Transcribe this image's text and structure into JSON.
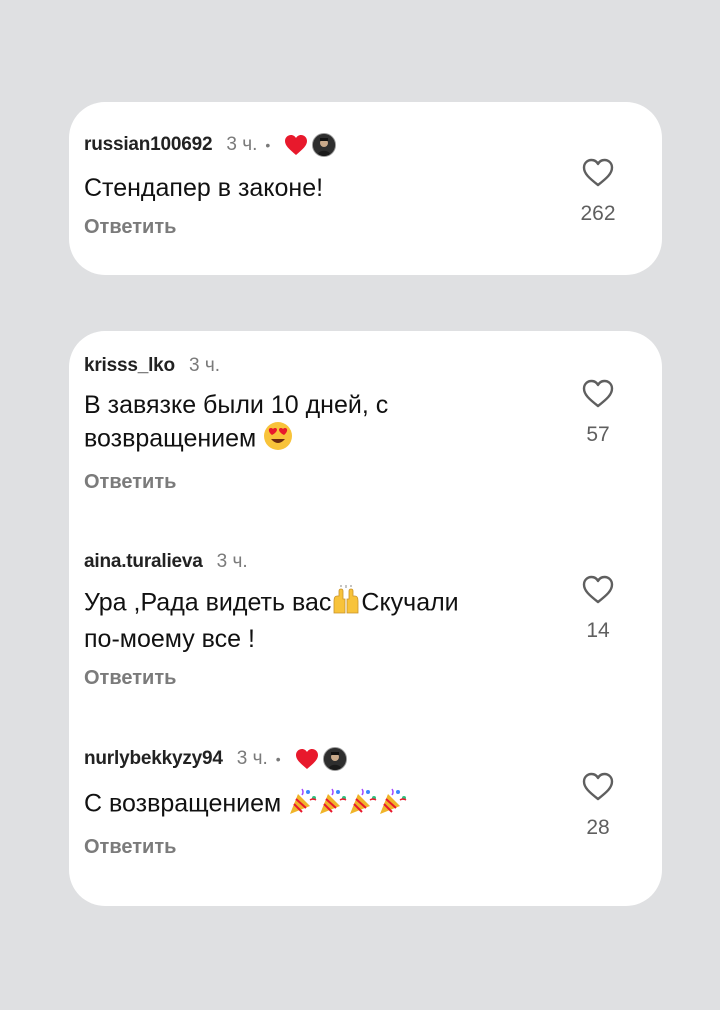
{
  "comments": [
    {
      "user": "russian100692",
      "time": "3 ч.",
      "dot": "•",
      "text": "Стендапер в законе!",
      "reply": "Ответить",
      "likes": "262",
      "liked_by_author": true
    },
    {
      "user": "krisss_lko",
      "time": "3 ч.",
      "text_line1": "В завязке были 10 дней, с",
      "text_line2": "возвращением",
      "text_emoji": "heart-eyes-emoji",
      "reply": "Ответить",
      "likes": "57",
      "liked_by_author": false
    },
    {
      "user": "aina.turalieva",
      "time": "3 ч.",
      "text_line1a": "Ура ,Рада видеть вас",
      "text_emoji": "raised-hands-emoji",
      "text_line1b": "Скучали",
      "text_line2": "по-моему все !",
      "reply": "Ответить",
      "likes": "14",
      "liked_by_author": false
    },
    {
      "user": "nurlybekkyzy94",
      "time": "3 ч.",
      "dot": "•",
      "text": "С возвращением",
      "text_emoji": "party-popper-emoji x4",
      "reply": "Ответить",
      "likes": "28",
      "liked_by_author": true
    }
  ],
  "colors": {
    "background": "#dfe0e2",
    "card": "#ffffff",
    "heart_liked": "#e8192c",
    "muted": "#7b7b7b"
  },
  "icons": {
    "like": "heart-outline-icon",
    "liked": "heart-filled-icon",
    "author_avatar": "author-avatar"
  }
}
